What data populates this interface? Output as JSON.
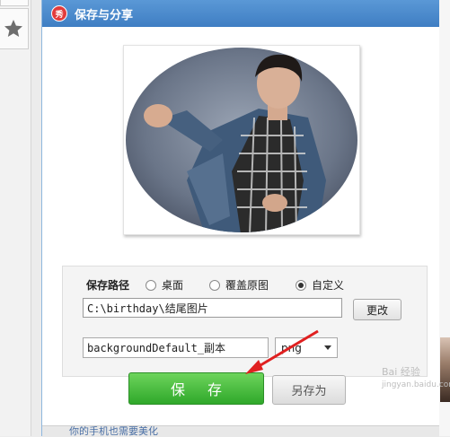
{
  "dialog": {
    "title": "保存与分享",
    "app_icon_text": "秀"
  },
  "save_path": {
    "label": "保存路径",
    "options": [
      {
        "label": "桌面",
        "selected": false
      },
      {
        "label": "覆盖原图",
        "selected": false
      },
      {
        "label": "自定义",
        "selected": true
      }
    ],
    "value": "C:\\birthday\\结尾图片",
    "change_button": "更改"
  },
  "file": {
    "name": "backgroundDefault_副本",
    "format": "png"
  },
  "buttons": {
    "save": "保 存",
    "save_as": "另存为"
  },
  "footer": {
    "tip": "你的手机也需要美化"
  },
  "watermark": {
    "line1": "Bai 经验",
    "line2": "jingyan.baidu.com"
  },
  "colors": {
    "title_bar": "#4a8ccd",
    "save_button": "#3cb034",
    "annotation_arrow": "#e02020"
  }
}
